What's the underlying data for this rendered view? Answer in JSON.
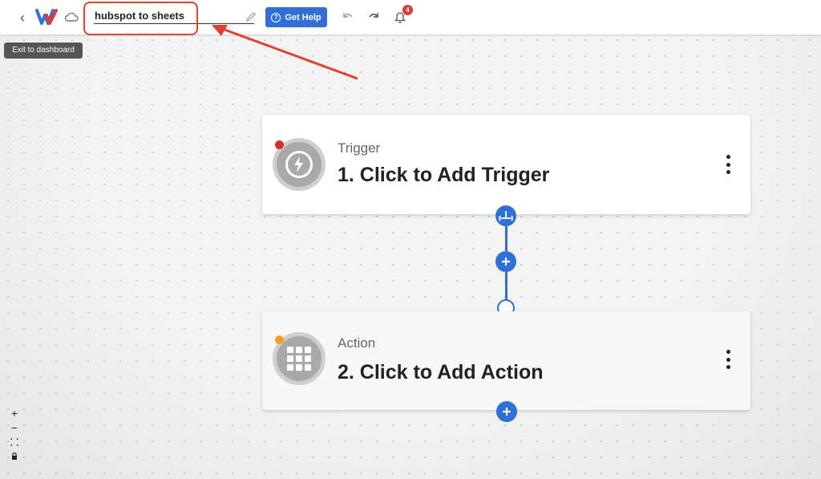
{
  "header": {
    "back_icon": "chevron-left-icon",
    "logo_icon": "w-logo-icon",
    "save_status_icon": "cloud-icon",
    "workflow_name": "hubspot to sheets",
    "edit_icon": "pencil-icon",
    "help_button": "Get Help",
    "help_icon": "question-circle-icon",
    "undo_icon": "undo-icon",
    "redo_icon": "redo-icon",
    "notifications_icon": "bell-icon",
    "notifications_count": "4"
  },
  "tooltip": {
    "text": "Exit to dashboard"
  },
  "annotation": {
    "color": "#e0412e"
  },
  "trigger_card": {
    "type_label": "Trigger",
    "title": "1. Click to Add Trigger",
    "icon": "lightning-bolt-icon",
    "status_color": "#d32f2f"
  },
  "action_card": {
    "type_label": "Action",
    "title": "2. Click to Add Action",
    "icon": "app-grid-icon",
    "status_color": "#f0a020"
  },
  "canvas_controls": {
    "zoom_in": "+",
    "zoom_out": "−",
    "fit_icon": "fit-view-icon",
    "lock_icon": "lock-icon"
  },
  "colors": {
    "accent": "#2f6fd6",
    "background": "#f3f3f3"
  }
}
